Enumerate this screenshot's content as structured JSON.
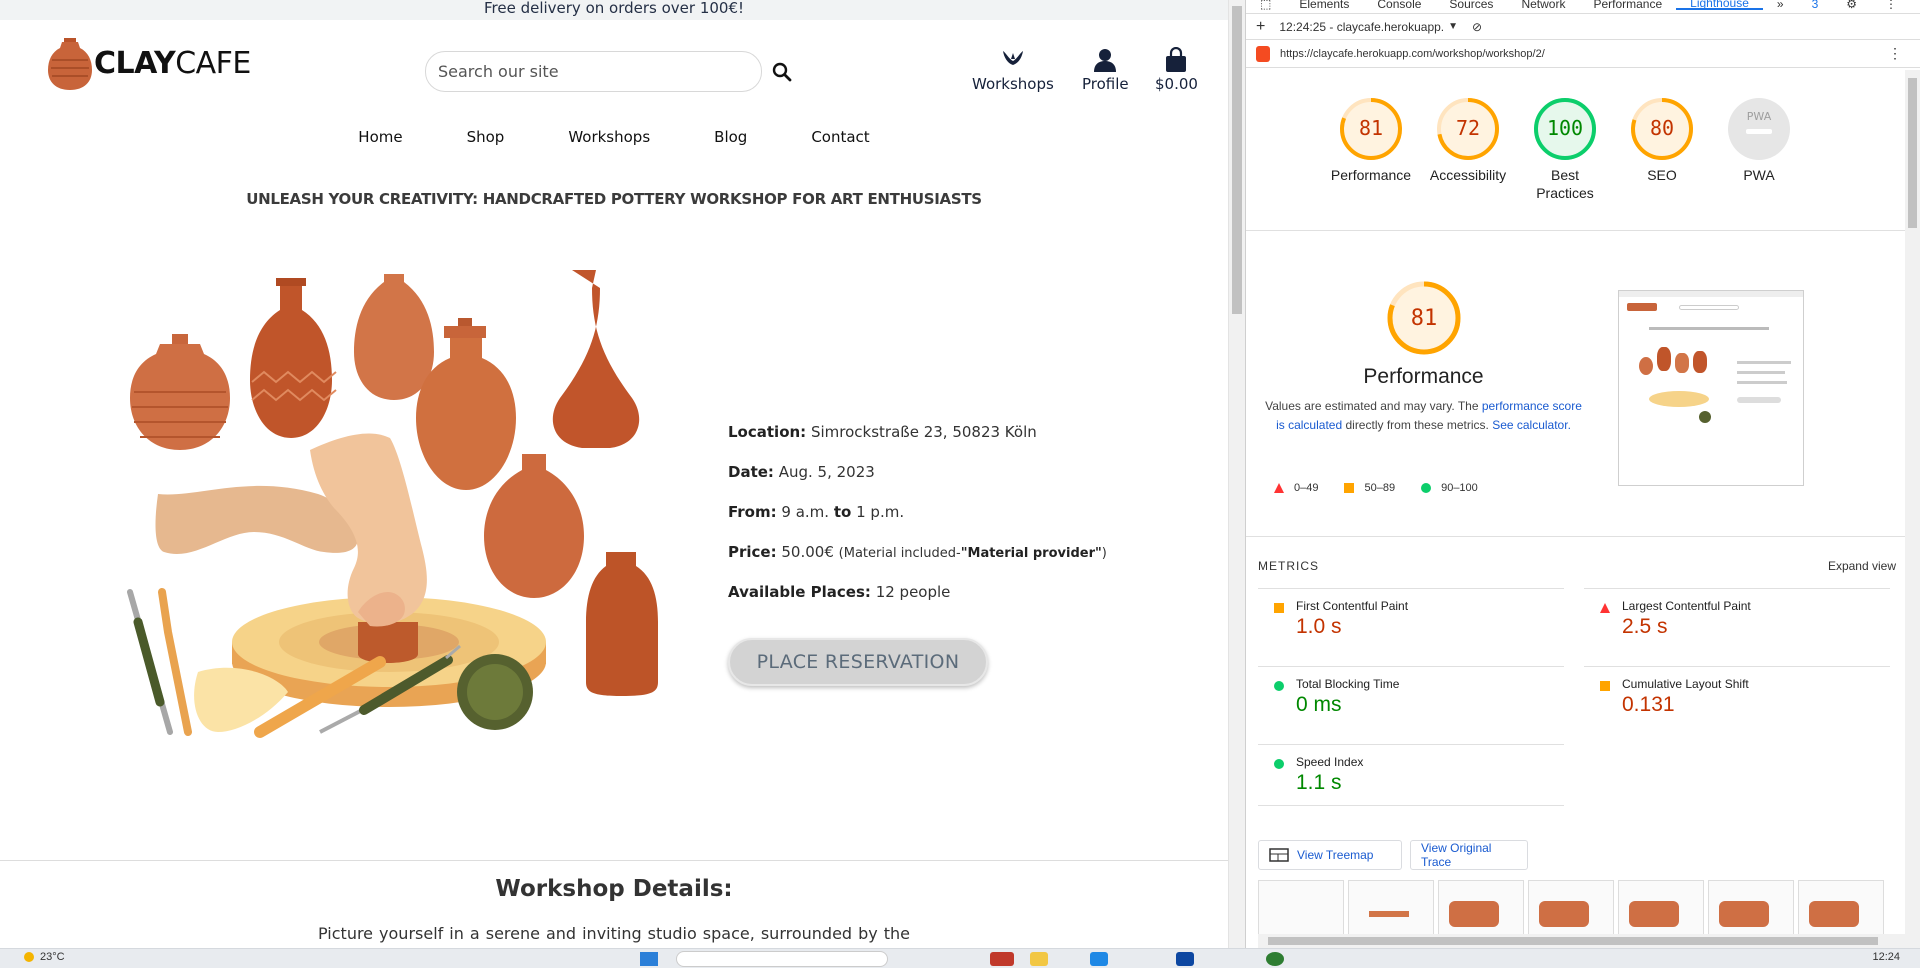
{
  "site": {
    "promo": "Free delivery on orders over 100€!",
    "logo": {
      "bold": "CLAY",
      "light": "CAFE"
    },
    "search": {
      "placeholder": "Search our site"
    },
    "top_icons": [
      {
        "label": "Workshops",
        "icon": "workshop-icon"
      },
      {
        "label": "Profile",
        "icon": "person-icon"
      },
      {
        "label": "$0.00",
        "icon": "shopping-bag-icon"
      }
    ],
    "nav": [
      "Home",
      "Shop",
      "Workshops",
      "Blog",
      "Contact"
    ],
    "headline": "UNLEASH YOUR CREATIVITY: HANDCRAFTED POTTERY WORKSHOP FOR ART ENTHUSIASTS",
    "info": {
      "location_label": "Location:",
      "location_value": "Simrockstraße 23, 50823 Köln",
      "date_label": "Date:",
      "date_value": "Aug. 5, 2023",
      "from_label": "From:",
      "from_start": "9 a.m.",
      "to_label": "to",
      "from_end": "1 p.m.",
      "price_label": "Price:",
      "price_value": "50.00€",
      "price_note_prefix": "(Material included-",
      "price_note_bold": "\"Material provider\"",
      "price_note_suffix": ")",
      "places_label": "Available Places:",
      "places_value": "12 people"
    },
    "reserve_button": "PLACE RESERVATION",
    "details_title": "Workshop Details:",
    "details_text": "Picture yourself in a serene and inviting studio space, surrounded by the earthy"
  },
  "devtools": {
    "tabs": [
      "Elements",
      "Console",
      "Sources",
      "Network",
      "Performance",
      "Lighthouse"
    ],
    "active_tab": "Lighthouse",
    "badge_count": "3",
    "report_selector": "12:24:25 - claycafe.herokuapp.",
    "url": "https://claycafe.herokuapp.com/workshop/workshop/2/",
    "scores": [
      {
        "label": "Performance",
        "value": "81",
        "color": "#e67700",
        "bg": "#fff3e0",
        "ring": "#ffa400"
      },
      {
        "label": "Accessibility",
        "value": "72",
        "color": "#c33300",
        "bg": "#fff3e0",
        "ring": "#ffa400"
      },
      {
        "label": "Best Practices",
        "value": "100",
        "color": "#008800",
        "bg": "#e6f8ec",
        "ring": "#0cce6b"
      },
      {
        "label": "SEO",
        "value": "80",
        "color": "#c33300",
        "bg": "#fff3e0",
        "ring": "#ffa400"
      },
      {
        "label": "PWA",
        "value": "PWA",
        "color": "#9e9e9e",
        "bg": "#e8e8e8",
        "ring": "#dadada"
      }
    ],
    "perf": {
      "score": "81",
      "title": "Performance",
      "desc_1": "Values are estimated and may vary. The ",
      "link_1": "performance score is calculated",
      "desc_2": " directly from these metrics. ",
      "link_2": "See calculator."
    },
    "legend": [
      "0–49",
      "50–89",
      "90–100"
    ],
    "metrics_heading": "METRICS",
    "expand_view": "Expand view",
    "metrics": [
      {
        "name": "First Contentful Paint",
        "value": "1.0 s",
        "status": "average",
        "color": "#c33300"
      },
      {
        "name": "Largest Contentful Paint",
        "value": "2.5 s",
        "status": "fail",
        "color": "#c33300"
      },
      {
        "name": "Total Blocking Time",
        "value": "0 ms",
        "status": "pass",
        "color": "#008800"
      },
      {
        "name": "Cumulative Layout Shift",
        "value": "0.131",
        "status": "average",
        "color": "#c33300"
      },
      {
        "name": "Speed Index",
        "value": "1.1 s",
        "status": "pass",
        "color": "#008800"
      }
    ],
    "view_treemap": "View Treemap",
    "view_trace": "View Original Trace"
  },
  "taskbar": {
    "weather": "23°C",
    "time": "12:24"
  }
}
